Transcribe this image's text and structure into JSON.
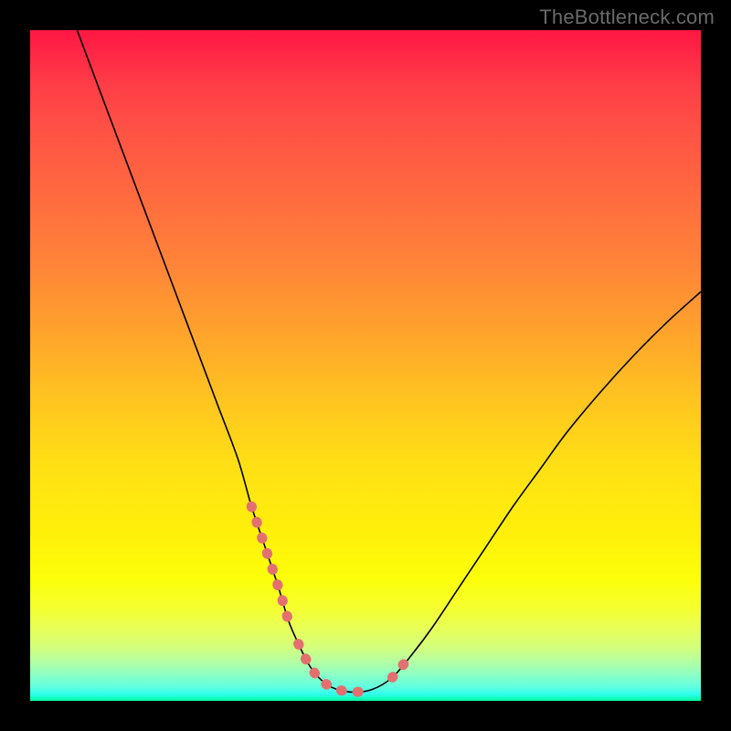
{
  "watermark": "TheBottleneck.com",
  "chart_data": {
    "type": "line",
    "title": "",
    "xlabel": "",
    "ylabel": "",
    "xlim": [
      0,
      100
    ],
    "ylim": [
      0,
      100
    ],
    "series": [
      {
        "name": "curve",
        "x": [
          7,
          10,
          13,
          16,
          19,
          22,
          25,
          28,
          31,
          33,
          35,
          37,
          38.5,
          40,
          41.5,
          43,
          45,
          48,
          51,
          54,
          57,
          60,
          64,
          68,
          72,
          76,
          80,
          85,
          90,
          95,
          100
        ],
        "y": [
          100,
          92,
          84,
          76,
          68,
          60,
          52,
          44,
          36,
          29,
          23,
          17,
          12,
          8.5,
          5.5,
          3.5,
          2,
          1.3,
          1.7,
          3.5,
          7,
          11,
          17,
          23,
          29,
          34.5,
          40,
          46,
          51.5,
          56.5,
          61
        ]
      }
    ],
    "markers": [
      {
        "x_range": [
          33,
          38.5
        ],
        "note": "left-descent-dots"
      },
      {
        "x_range": [
          40,
          52
        ],
        "note": "valley-dots"
      },
      {
        "x_range": [
          54,
          58
        ],
        "note": "right-ascent-dots"
      }
    ],
    "background": "vertical-gradient red→orange→yellow→green"
  }
}
